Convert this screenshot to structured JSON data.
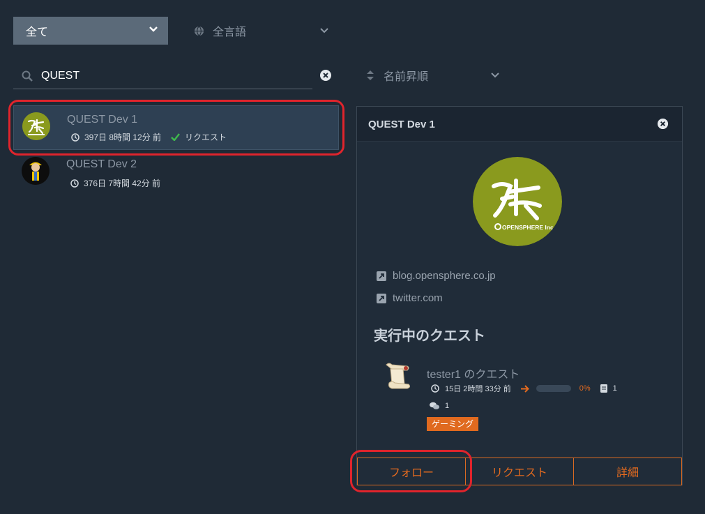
{
  "filters": {
    "category": "全て",
    "language": "全言語",
    "sort": "名前昇順"
  },
  "search": {
    "value": "QUEST",
    "placeholder": ""
  },
  "list": [
    {
      "name": "QUEST Dev 1",
      "time": "397日 8時間 12分 前",
      "request_label": "リクエスト",
      "selected": true
    },
    {
      "name": "QUEST Dev 2",
      "time": "376日 7時間 42分 前",
      "selected": false
    }
  ],
  "panel": {
    "title": "QUEST Dev 1",
    "logo_text": "OPENSPHERE Inc.",
    "links": [
      "blog.opensphere.co.jp",
      "twitter.com"
    ],
    "section_title": "実行中のクエスト",
    "quest": {
      "name": "tester1 のクエスト",
      "time": "15日 2時間 33分 前",
      "progress_percent": 0,
      "progress_label": "0%",
      "docs_count": "1",
      "comments_count": "1",
      "tag": "ゲーミング"
    },
    "actions": {
      "follow": "フォロー",
      "request": "リクエスト",
      "details": "詳細"
    }
  },
  "colors": {
    "background": "#1f2a36",
    "accent": "#e56b1f",
    "highlight": "#e0242c",
    "logo_green": "#8a9a1e"
  }
}
